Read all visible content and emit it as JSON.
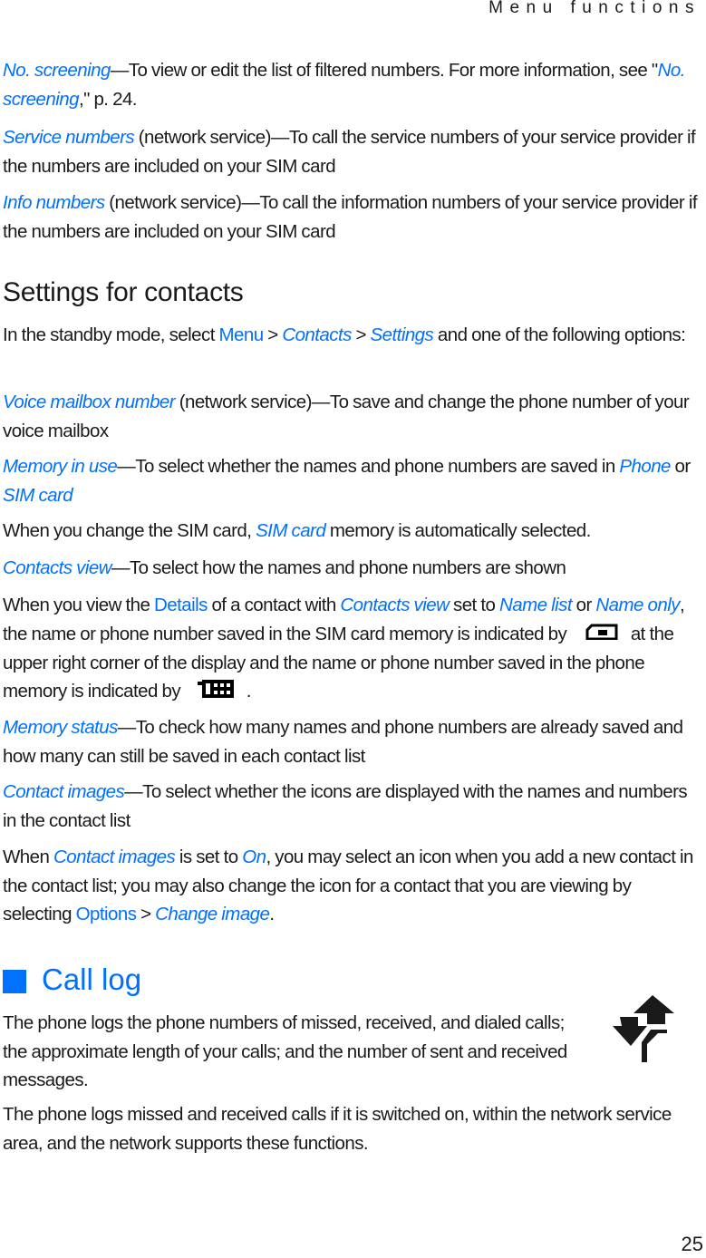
{
  "header": {
    "running_head": "Menu functions"
  },
  "paragraphs": {
    "no_screening": {
      "term": "No. screening",
      "desc": "—To view or edit the list of filtered numbers. For more information, see \"",
      "ref": "No. screening",
      "after": ",\" p. 24."
    },
    "service_numbers": {
      "term": "Service numbers",
      "desc": " (network service)—To call the service numbers of your service provider if the numbers are included on your SIM card"
    },
    "info_numbers": {
      "term": "Info numbers",
      "desc": " (network service)—To call the information numbers of your service provider if the numbers are included on your SIM card"
    }
  },
  "settings_section": {
    "title": "Settings for contacts",
    "intro": {
      "t1": "In the standby mode, select ",
      "menu": "Menu",
      "sep1": " > ",
      "contacts": "Contacts",
      "sep2": " > ",
      "settings": "Settings",
      "t2": " and one of the following options:"
    },
    "voice_mailbox": {
      "term": "Voice mailbox number",
      "desc": " (network service)—To save and change the phone number of your voice mailbox"
    },
    "memory_in_use": {
      "term": "Memory in use",
      "desc": "—To select whether the names and phone numbers are saved in ",
      "opt1": "Phone",
      "or": " or ",
      "opt2": "SIM card"
    },
    "sim_change": {
      "t1": "When you change the SIM card, ",
      "term": "SIM card",
      "t2": " memory is automatically selected."
    },
    "contacts_view": {
      "term": "Contacts view",
      "desc": "—To select how the names and phone numbers are shown"
    },
    "details_note": {
      "t1": "When you view the ",
      "details": "Details",
      "t2": " of a contact with ",
      "contacts_view": "Contacts view",
      "t3": " set to ",
      "name_list": "Name list",
      "t4": " or ",
      "name_only": "Name only",
      "t5": ", the name or phone number saved in the SIM card memory is indicated by",
      "t6": "at the upper right corner of the display and the name or phone number saved in the phone memory is indicated by",
      "t7": "."
    },
    "memory_status": {
      "term": "Memory status",
      "desc": "—To check how many names and phone numbers are already saved and how many can still be saved in each contact list"
    },
    "contact_images": {
      "term": "Contact images",
      "desc": "—To select whether the icons are displayed with the names and numbers in the contact list"
    },
    "contact_images_note": {
      "t1": "When ",
      "term": "Contact images",
      "t2": " is set to ",
      "on": "On",
      "t3": ", you may select an icon when you add a new contact in the contact list; you may also change the icon for a contact that you are viewing by selecting ",
      "options": "Options",
      "sep": " > ",
      "change_image": "Change image",
      "t4": "."
    }
  },
  "call_log_section": {
    "title": "Call log",
    "p1": "The phone logs the phone numbers of missed, received, and dialed calls; the approximate length of your calls; and the number of sent and received messages.",
    "p2": "The phone logs missed and received calls if it is switched on, within the network service area, and the network supports these functions."
  },
  "footer": {
    "page_number": "25"
  },
  "colors": {
    "accent": "#0070ff",
    "text": "#1a1a1a"
  }
}
